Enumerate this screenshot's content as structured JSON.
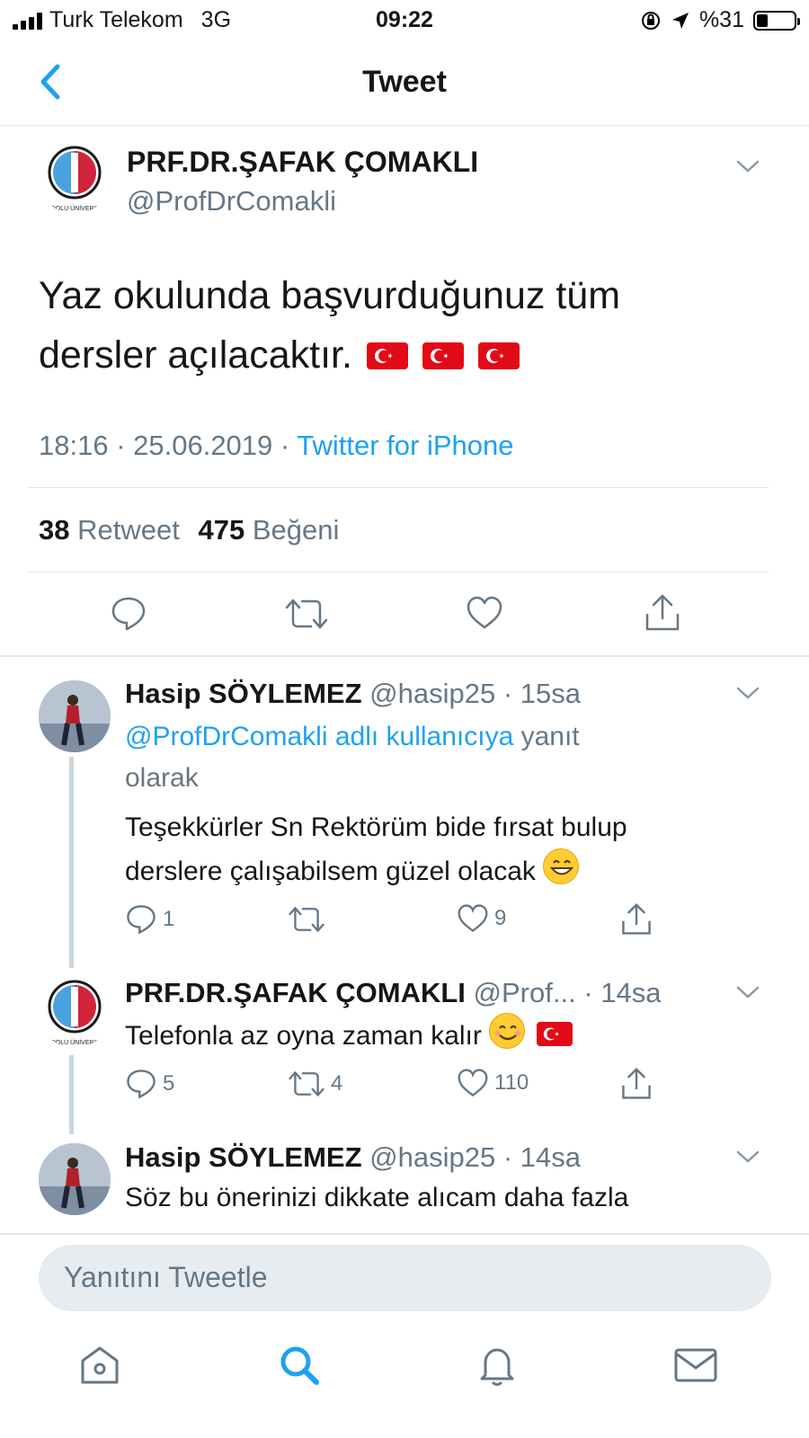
{
  "status_bar": {
    "carrier": "Turk Telekom",
    "network": "3G",
    "time": "09:22",
    "battery": "%31",
    "battery_level": 0.31
  },
  "nav": {
    "title": "Tweet"
  },
  "main_tweet": {
    "name": "PRF.DR.ŞAFAK ÇOMAKLI",
    "handle": "@ProfDrComakli",
    "text_line1": "Yaz okulunda başvurduğunuz tüm",
    "text_line2": "dersler açılacaktır.",
    "time": "18:16 · 25.06.2019 · ",
    "source": "Twitter for iPhone",
    "retweet_count": "38",
    "retweet_label": "Retweet",
    "like_count": "475",
    "like_label": "Beğeni",
    "logo_text": "DOLU ÜNİVERS"
  },
  "replies": [
    {
      "name": "Hasip SÖYLEMEZ",
      "handle": "@hasip25",
      "time": "· 15sa",
      "reply_to": "@ProfDrComakli adlı kullanıcıya",
      "reply_suffix": " yanıt",
      "reply_suffix2": "olarak",
      "text_line1": "Teşekkürler Sn Rektörüm bide fırsat bulup",
      "text_line2": "derslere çalışabilsem güzel olacak",
      "reply_count": "1",
      "retweet_count": "",
      "like_count": "9"
    },
    {
      "name": "PRF.DR.ŞAFAK ÇOMAKLI",
      "handle": "@Prof...",
      "time": "· 14sa",
      "text_line1": "Telefonla az oyna zaman kalır",
      "reply_count": "5",
      "retweet_count": "4",
      "like_count": "110",
      "logo_text": "DOLU ÜNİVERS"
    },
    {
      "name": "Hasip SÖYLEMEZ",
      "handle": "@hasip25",
      "time": "· 14sa",
      "text_line1": "Söz bu önerinizi dikkate alıcam daha fazla"
    }
  ],
  "composer": {
    "placeholder": "Yanıtını Tweetle"
  },
  "colors": {
    "accent": "#1da1f2",
    "secondary_text": "#657786",
    "flag_red": "#e30a17"
  },
  "tabbar": {
    "icons": [
      "home-icon",
      "search-icon",
      "bell-icon",
      "mail-icon"
    ],
    "active": "search-icon"
  }
}
